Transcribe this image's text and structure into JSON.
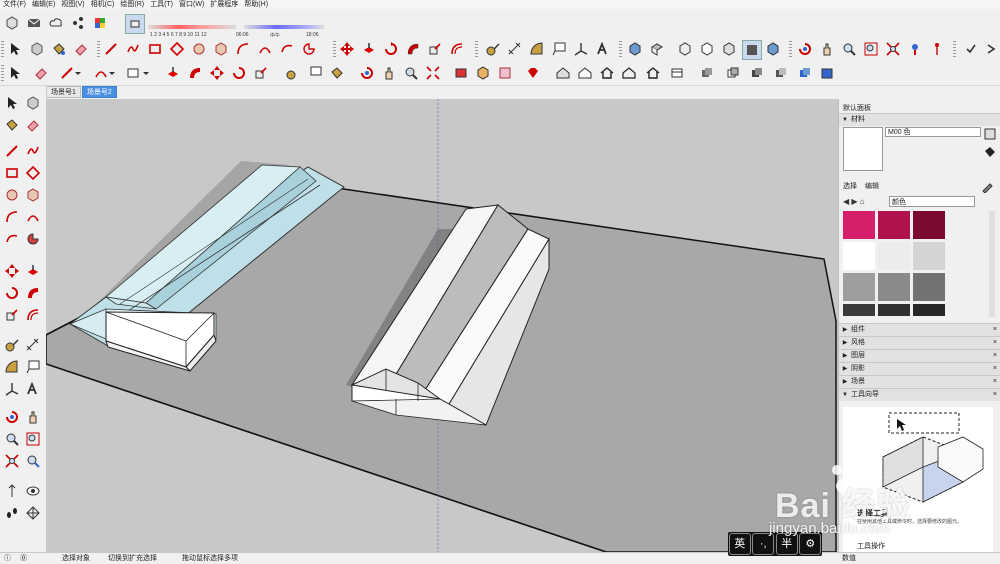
{
  "menubar": {
    "items": [
      "文件(F)",
      "编辑(E)",
      "视图(V)",
      "相机(C)",
      "绘图(R)",
      "工具(T)",
      "窗口(W)",
      "扩展程序",
      "帮助(H)"
    ]
  },
  "shadow_settings": {
    "time_labels": "1 2 3 4 5 6 7 8 9 10 11 12",
    "left_time": "06:06",
    "mid_label": "中午",
    "right_time": "18:06"
  },
  "scene_tabs": [
    {
      "label": "场景号1",
      "active": false
    },
    {
      "label": "场景号2",
      "active": true
    }
  ],
  "tray": {
    "title": "默认面板",
    "materials_header": "材料",
    "material_name": "M00 色",
    "tabs": [
      "选择",
      "编辑"
    ],
    "library_select": "颜色",
    "swatch_colors": [
      "#d61e6a",
      "#b0124e",
      "#7a0a32",
      "#ffffff",
      "#ececec",
      "#d4d4d4",
      "#9e9e9e",
      "#8a8a8a",
      "#727272",
      "#3a3a3a",
      "#303030",
      "#262626"
    ],
    "sections": [
      "组件",
      "风格",
      "图层",
      "阴影",
      "场景"
    ],
    "instructor_header": "工具向导",
    "instructor_title": "选择工具",
    "instructor_desc": "在使用其他工具或命令时，选择要修改的图元。",
    "instructor_ops": "工具操作"
  },
  "statusbar": {
    "icons": [
      "ⓘ",
      "⓪"
    ],
    "left": "选择对象",
    "mid1": "切换到扩充选择",
    "mid2": "拖动鼠标选择多项",
    "right": "数值"
  },
  "ime": {
    "lang": "英",
    "punct": "·,",
    "width": "半",
    "settings": "⚙"
  },
  "watermark": {
    "text": "Bai 经验",
    "url": "jingyan.baidu.com"
  },
  "colors": {
    "accent": "#4a8fe0",
    "ground": "#a8a8a8",
    "sky": "#c8c8c8",
    "glass": "#bfe0e8"
  }
}
